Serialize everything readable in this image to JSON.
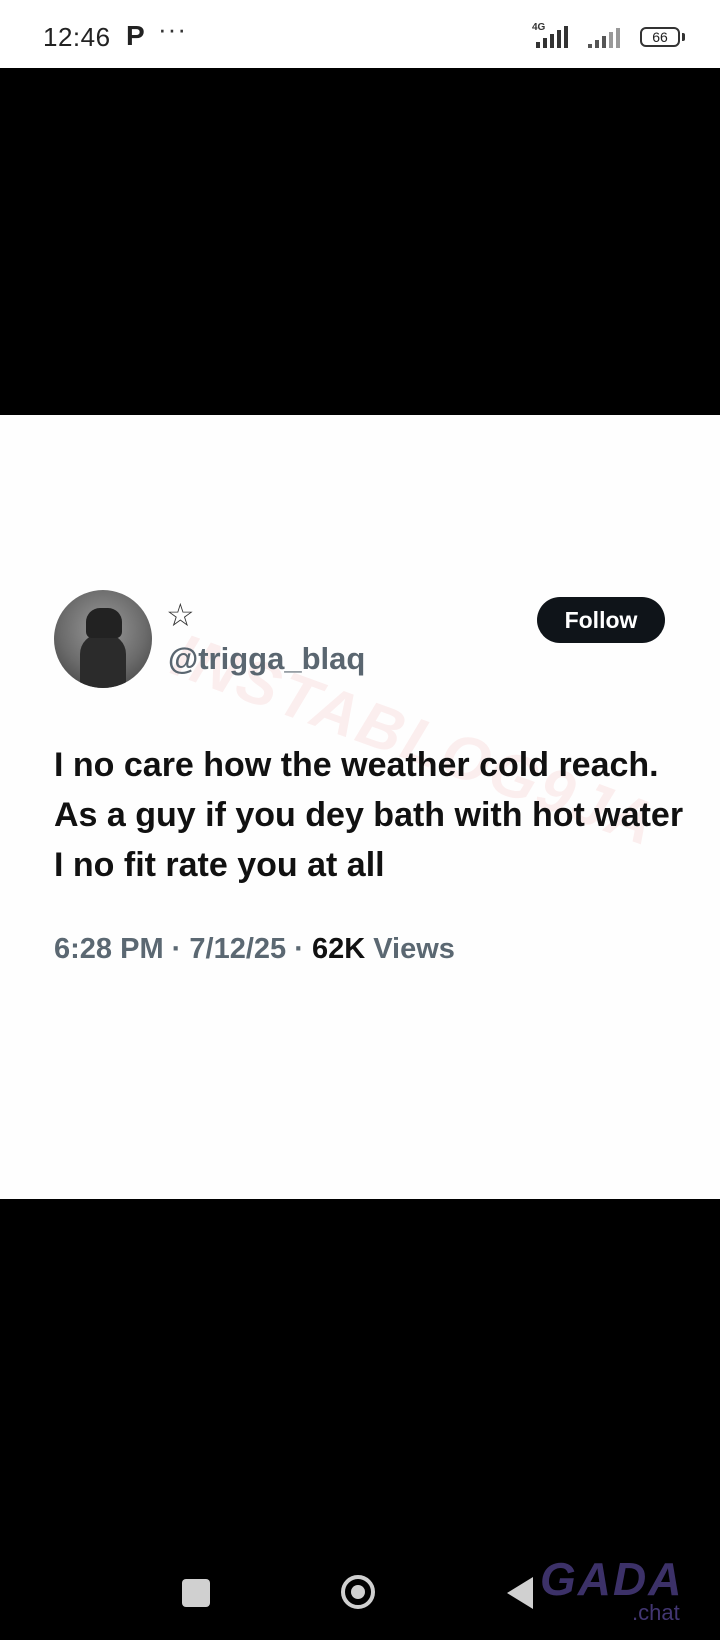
{
  "status_bar": {
    "time": "12:46",
    "notification_letter": "P",
    "more_dots": "···",
    "network_type": "4G",
    "battery_level": "66"
  },
  "tweet": {
    "handle": "@trigga_blaq",
    "follow_label": "Follow",
    "text": "I no care how the weather cold reach. As a guy if you dey bath with hot water I no fit rate you at all",
    "time": "6:28 PM",
    "date": "7/12/25",
    "views_count": "62K",
    "views_label": "Views",
    "watermark": "INSTABLOG9JA",
    "follow_button_color": "#0f1419"
  },
  "navigation": {
    "icons": [
      "recent-apps-icon",
      "home-icon",
      "back-icon"
    ]
  },
  "overlay": {
    "logo": "GADA",
    "logo_sub": ".chat"
  }
}
